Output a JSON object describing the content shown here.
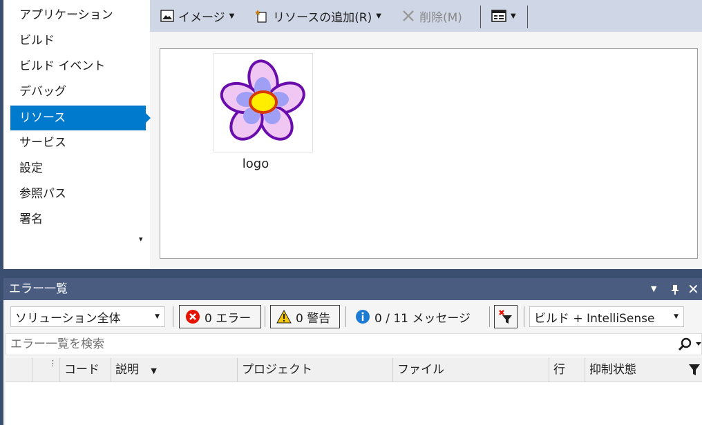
{
  "sidebar": {
    "items": [
      {
        "label": "アプリケーション"
      },
      {
        "label": "ビルド"
      },
      {
        "label": "ビルド イベント"
      },
      {
        "label": "デバッグ"
      },
      {
        "label": "リソース",
        "active": true
      },
      {
        "label": "サービス"
      },
      {
        "label": "設定"
      },
      {
        "label": "参照パス"
      },
      {
        "label": "署名"
      }
    ],
    "scroll_glyph": "▾"
  },
  "resources_toolbar": {
    "image_label": "イメージ",
    "add_resource_label": "リソースの追加(R)",
    "delete_label": "削除(M)"
  },
  "resources": {
    "items": [
      {
        "label": "logo",
        "icon": "flower-image"
      }
    ]
  },
  "error_list": {
    "title": "エラー一覧",
    "scope_value": "ソリューション全体",
    "errors_label": "0 エラー",
    "warnings_label": "0 警告",
    "messages_label": "0 / 11 メッセージ",
    "build_filter_value": "ビルド + IntelliSense",
    "search_placeholder": "エラー一覧を検索",
    "columns": {
      "code": "コード",
      "description": "説明",
      "project": "プロジェクト",
      "file": "ファイル",
      "line": "行",
      "suppression": "抑制状態"
    }
  },
  "colors": {
    "accent": "#007acc",
    "title_bar": "#4a5d80",
    "error_red": "#e51400",
    "warning_yellow": "#f5c60f",
    "info_blue": "#1e7bd3"
  }
}
